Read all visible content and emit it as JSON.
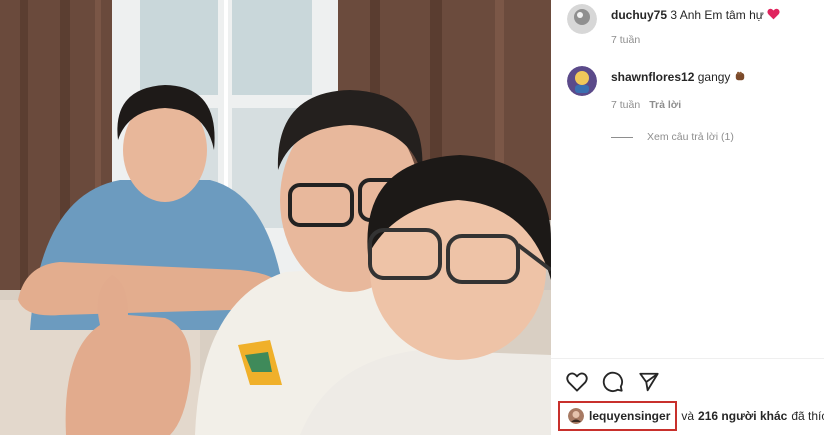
{
  "post": {
    "photo_icon": "selfie-photo"
  },
  "comments": [
    {
      "username": "duchuy75",
      "text": "3 Anh Em tâm hự",
      "emoji": "red-heart",
      "time": "7 tuần"
    },
    {
      "username": "shawnflores12",
      "text": "gangy",
      "emoji": "fist-emoji",
      "time": "7 tuần",
      "reply_label": "Trả lời",
      "view_replies": "Xem câu trả lời (1)"
    }
  ],
  "actions": {
    "like_icon": "heart-icon",
    "comment_icon": "comment-icon",
    "share_icon": "share-icon"
  },
  "likes": {
    "liker": "lequyensinger",
    "connector": "và",
    "count": "216 người khác",
    "suffix": "đã thích"
  },
  "colors": {
    "highlight_border": "#c8302c",
    "heart": "#e0245e"
  }
}
